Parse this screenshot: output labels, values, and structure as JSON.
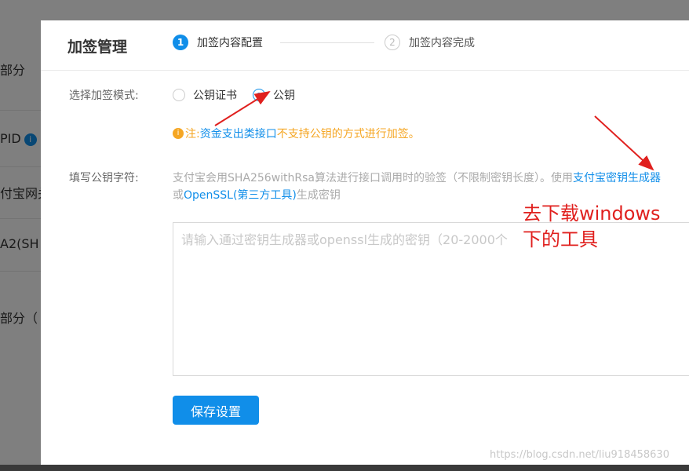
{
  "background": {
    "rows": [
      "部分",
      "PID",
      "付宝网关",
      "A2(SH",
      "部分（"
    ],
    "info_icon": "i"
  },
  "modal": {
    "title": "加签管理",
    "steps": [
      {
        "number": "1",
        "label": "加签内容配置"
      },
      {
        "number": "2",
        "label": "加签内容完成"
      }
    ],
    "mode_label": "选择加签模式:",
    "mode_options": [
      {
        "label": "公钥证书",
        "checked": false
      },
      {
        "label": "公钥",
        "checked": true
      }
    ],
    "notice": {
      "icon": "i",
      "prefix": "注:",
      "link": "资金支出类接口",
      "suffix": "不支持公钥的方式进行加签。"
    },
    "key_label": "填写公钥字符:",
    "desc_line1": "支付宝会用SHA256withRsa算法进行接口调用时的验签（不限制密钥长度）。使用",
    "desc_link1": "支付宝密钥生成器",
    "desc_line2_prefix": "或",
    "desc_link2": "OpenSSL(第三方工具)",
    "desc_line2_suffix": "生成密钥",
    "textarea_placeholder": "请输入通过密钥生成器或openssl生成的密钥（20-2000个",
    "textarea_value": "",
    "save_button": "保存设置"
  },
  "annotation": {
    "line1": "去下载windows",
    "line2": "下的工具",
    "color": "#e0201e"
  },
  "watermark": "https://blog.csdn.net/liu918458630",
  "colors": {
    "accent": "#108ee9",
    "warning": "#f5a623"
  }
}
